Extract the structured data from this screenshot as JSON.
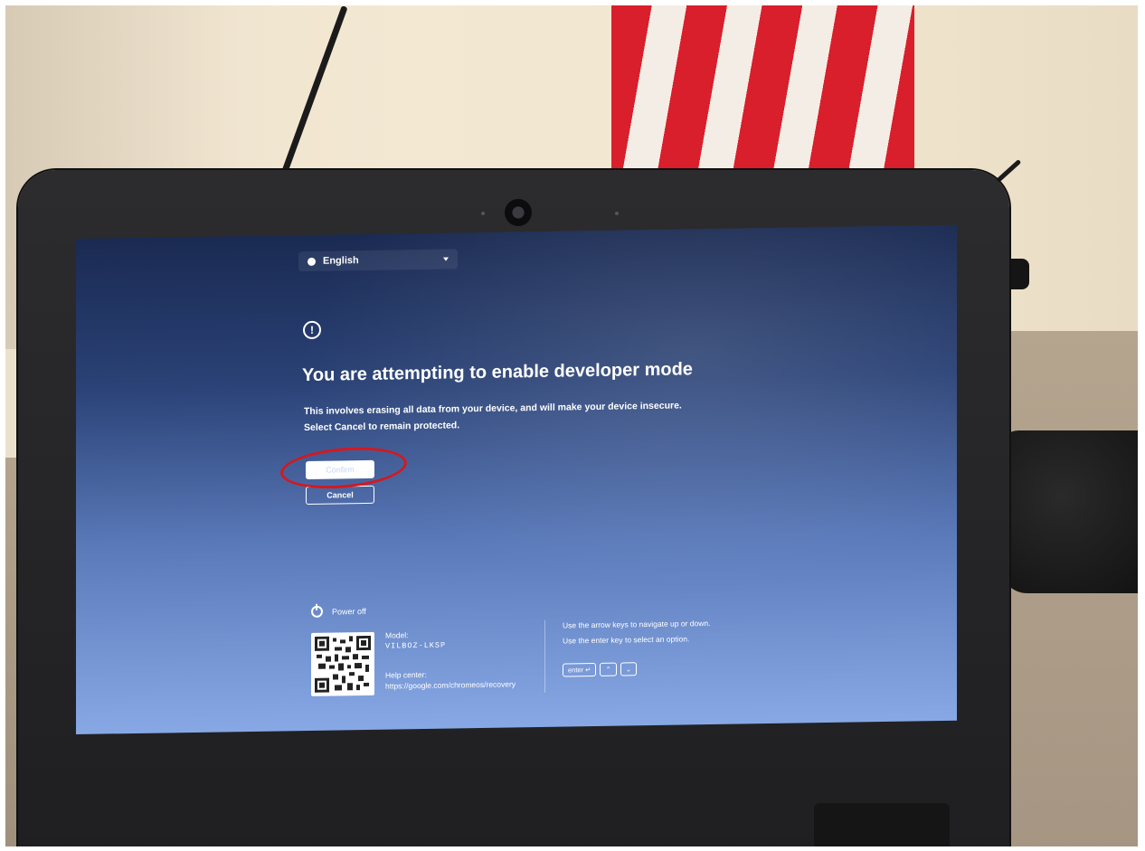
{
  "language_selector": {
    "label": "English",
    "globe_icon": "globe-icon",
    "dropdown_icon": "chevron-down-icon"
  },
  "dialog": {
    "icon": "warning-icon",
    "icon_glyph": "!",
    "title": "You are attempting to enable developer mode",
    "description_line1": "This involves erasing all data from your device, and will make your device insecure.",
    "description_line2": "Select Cancel to remain protected.",
    "confirm_label": "Confirm",
    "cancel_label": "Cancel",
    "highlight_color": "#d4181f"
  },
  "footer": {
    "power_off_label": "Power off",
    "power_icon": "power-icon",
    "model_label": "Model:",
    "model_value": "VILBOZ-LKSP",
    "help_center_label": "Help center:",
    "help_center_url": "https://google.com/chromeos/recovery",
    "nav_hint_line1": "Use the arrow keys to navigate up or down.",
    "nav_hint_line2": "Use the enter key to select an option.",
    "key_enter": "enter ↵",
    "key_up": "⌃",
    "key_down": "⌄"
  }
}
